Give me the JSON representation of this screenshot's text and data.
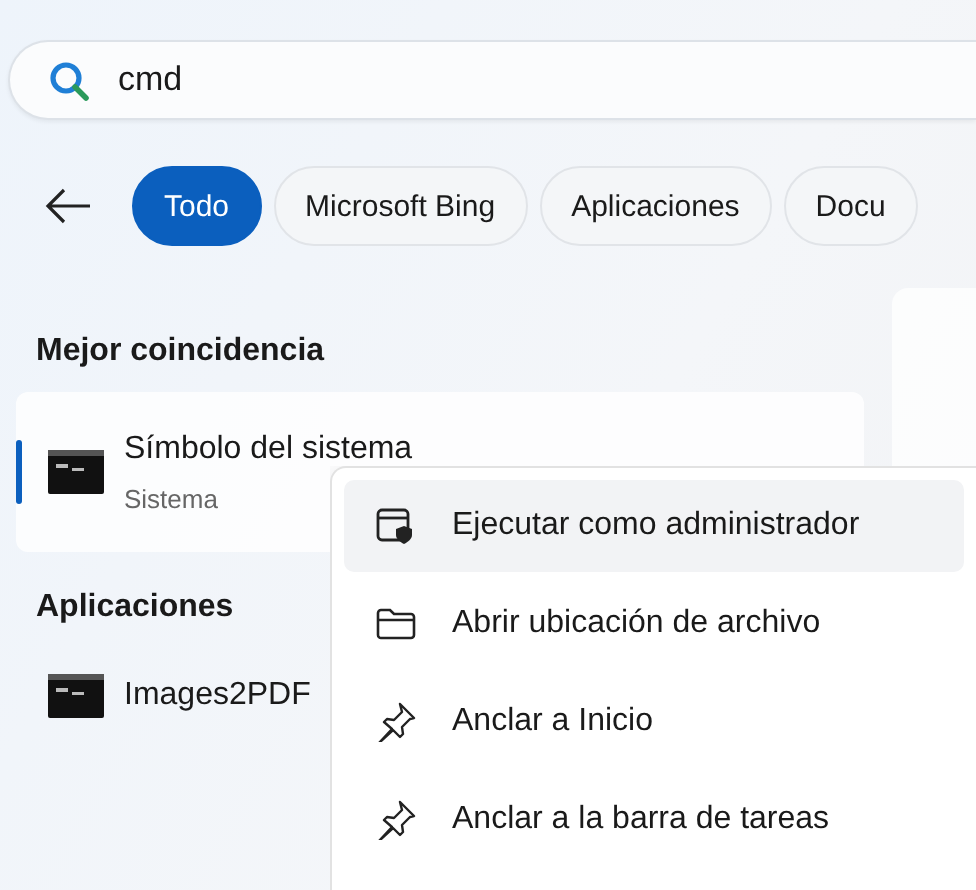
{
  "search": {
    "value": "cmd"
  },
  "filters": [
    {
      "label": "Todo",
      "selected": true
    },
    {
      "label": "Microsoft Bing",
      "selected": false
    },
    {
      "label": "Aplicaciones",
      "selected": false
    },
    {
      "label": "Docu",
      "selected": false
    }
  ],
  "sections": [
    {
      "title": "Mejor coincidencia",
      "items": [
        {
          "name": "Símbolo del sistema",
          "subtitle": "Sistema",
          "selected": true
        }
      ]
    },
    {
      "title": "Aplicaciones",
      "items": [
        {
          "name": "Images2PDF",
          "selected": false
        }
      ]
    }
  ],
  "context_menu": [
    {
      "kind": "admin",
      "label": "Ejecutar como administrador",
      "selected": true
    },
    {
      "kind": "folder",
      "label": "Abrir ubicación de archivo",
      "selected": false
    },
    {
      "kind": "pin",
      "label": "Anclar a Inicio",
      "selected": false
    },
    {
      "kind": "pin",
      "label": "Anclar a la barra de tareas",
      "selected": false
    }
  ]
}
